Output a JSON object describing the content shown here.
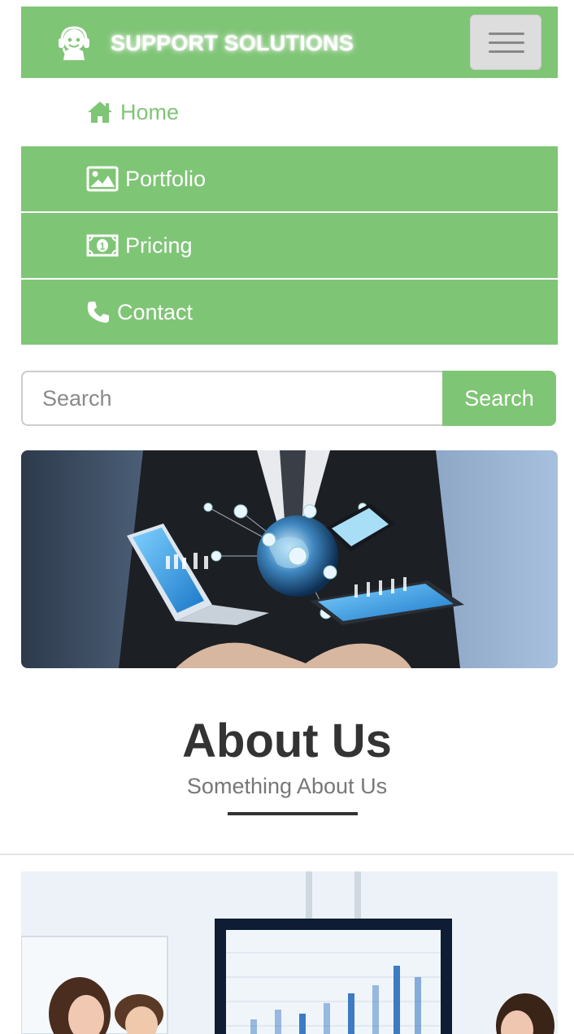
{
  "brand": {
    "title": "SUPPORT SOLUTIONS",
    "logo_icon": "headset-support-icon"
  },
  "nav": {
    "toggle_icon": "hamburger-menu-icon",
    "items": [
      {
        "label": "Home",
        "icon": "home-icon",
        "active": true
      },
      {
        "label": "Portfolio",
        "icon": "image-icon",
        "active": false
      },
      {
        "label": "Pricing",
        "icon": "money-icon",
        "active": false
      },
      {
        "label": "Contact",
        "icon": "phone-icon",
        "active": false
      }
    ]
  },
  "search": {
    "placeholder": "Search",
    "button_label": "Search"
  },
  "about": {
    "title": "About Us",
    "subtitle": "Something About Us"
  },
  "colors": {
    "accent": "#7fc576",
    "heading": "#333333",
    "subtitle": "#777777",
    "hamburger_bg": "#dddddd"
  }
}
